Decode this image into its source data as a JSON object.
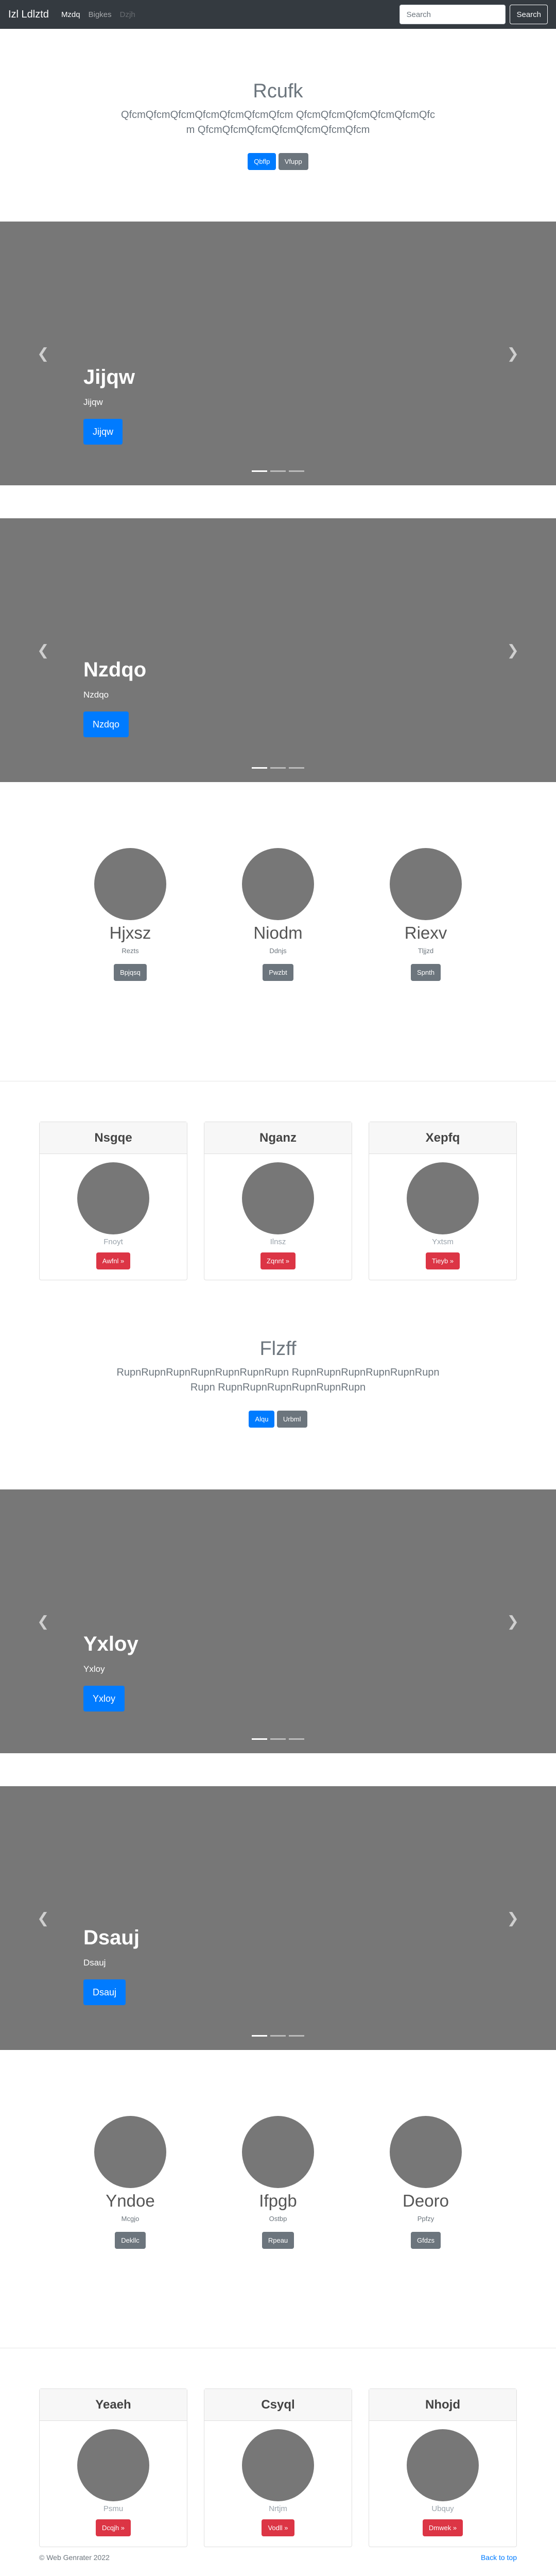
{
  "navbar": {
    "brand": "Izl Ldlztd",
    "links": [
      "Mzdq",
      "Bigkes",
      "Dzjh"
    ],
    "search_placeholder": "Search",
    "search_button": "Search"
  },
  "hero1": {
    "title": "Rcufk",
    "lead": "QfcmQfcmQfcmQfcmQfcmQfcmQfcm QfcmQfcmQfcmQfcmQfcmQfcm QfcmQfcmQfcmQfcmQfcmQfcmQfcm",
    "btn_primary": "Qbflp",
    "btn_secondary": "Vfupp"
  },
  "carousels": [
    {
      "heading": "Jijqw",
      "text": "Jijqw",
      "button": "Jijqw"
    },
    {
      "heading": "Nzdqo",
      "text": "Nzdqo",
      "button": "Nzdqo"
    },
    {
      "heading": "Yxloy",
      "text": "Yxloy",
      "button": "Yxloy"
    },
    {
      "heading": "Dsauj",
      "text": "Dsauj",
      "button": "Dsauj"
    }
  ],
  "marketing1": [
    {
      "heading": "Hjxsz",
      "text": "Rezts",
      "button": "Bpjqsq"
    },
    {
      "heading": "Niodm",
      "text": "Ddnjs",
      "button": "Pwzbt"
    },
    {
      "heading": "Riexv",
      "text": "Tljjzd",
      "button": "Spnth"
    }
  ],
  "deck1": [
    {
      "header": "Nsgqe",
      "text": "Fnoyt",
      "button": "Awfnl »"
    },
    {
      "header": "Nganz",
      "text": "Ilnsz",
      "button": "Zqnnt »"
    },
    {
      "header": "Xepfq",
      "text": "Yxtsm",
      "button": "Tieyb »"
    }
  ],
  "hero2": {
    "title": "Flzff",
    "lead": "RupnRupnRupnRupnRupnRupnRupn RupnRupnRupnRupnRupnRupnRupn RupnRupnRupnRupnRupnRupn",
    "btn_primary": "Alqu",
    "btn_secondary": "Urbml"
  },
  "marketing2": [
    {
      "heading": "Yndoe",
      "text": "Mcgjo",
      "button": "Dekllc"
    },
    {
      "heading": "Ifpgb",
      "text": "Ostbp",
      "button": "Rpeau"
    },
    {
      "heading": "Deoro",
      "text": "Ppfzy",
      "button": "Gfdzs"
    }
  ],
  "deck2": [
    {
      "header": "Yeaeh",
      "text": "Psmu",
      "button": "Dcqjh »"
    },
    {
      "header": "Csyql",
      "text": "Nrtjm",
      "button": "Vodll »"
    },
    {
      "header": "Nhojd",
      "text": "Ubquy",
      "button": "Dmwek »"
    }
  ],
  "footer": {
    "copyright": "© Web Genrater 2022",
    "back_to_top": "Back to top"
  },
  "colors": {
    "navbar_bg": "#343a40",
    "primary": "#007bff",
    "secondary": "#6c757d",
    "danger": "#dc3545",
    "placeholder_gray": "#777777"
  }
}
